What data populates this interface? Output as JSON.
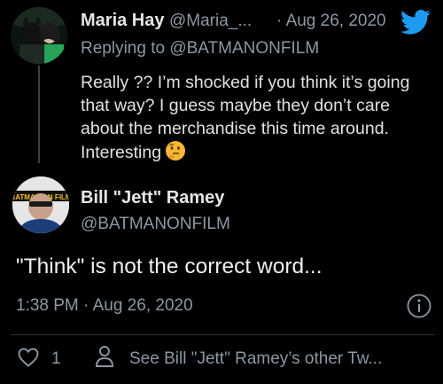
{
  "reply": {
    "author_name": "Maria Hay",
    "author_handle": "@Maria_...",
    "separator": "·",
    "date": "Aug 26, 2020",
    "replying_to": "Replying to @BATMANONFILM",
    "body": "Really ?? I’m shocked if you think it’s going that way? I guess maybe they don’t care about the merchandise this time around. Interesting",
    "emoji": "thinking-face"
  },
  "tweet": {
    "author_name": "Bill \"Jett\" Ramey",
    "author_handle": "@BATMANONFILM",
    "avatar_text": "BATMAN ON FILM",
    "text": "\"Think\" is not the correct word...",
    "timestamp": "1:38 PM · Aug 26, 2020",
    "likes": "1",
    "see_more": "See Bill \"Jett\" Ramey’s other Tw..."
  },
  "colors": {
    "background": "#000000",
    "secondary_text": "#8b98a5",
    "twitter_blue": "#1d9bf0",
    "divider": "#2f3336"
  }
}
